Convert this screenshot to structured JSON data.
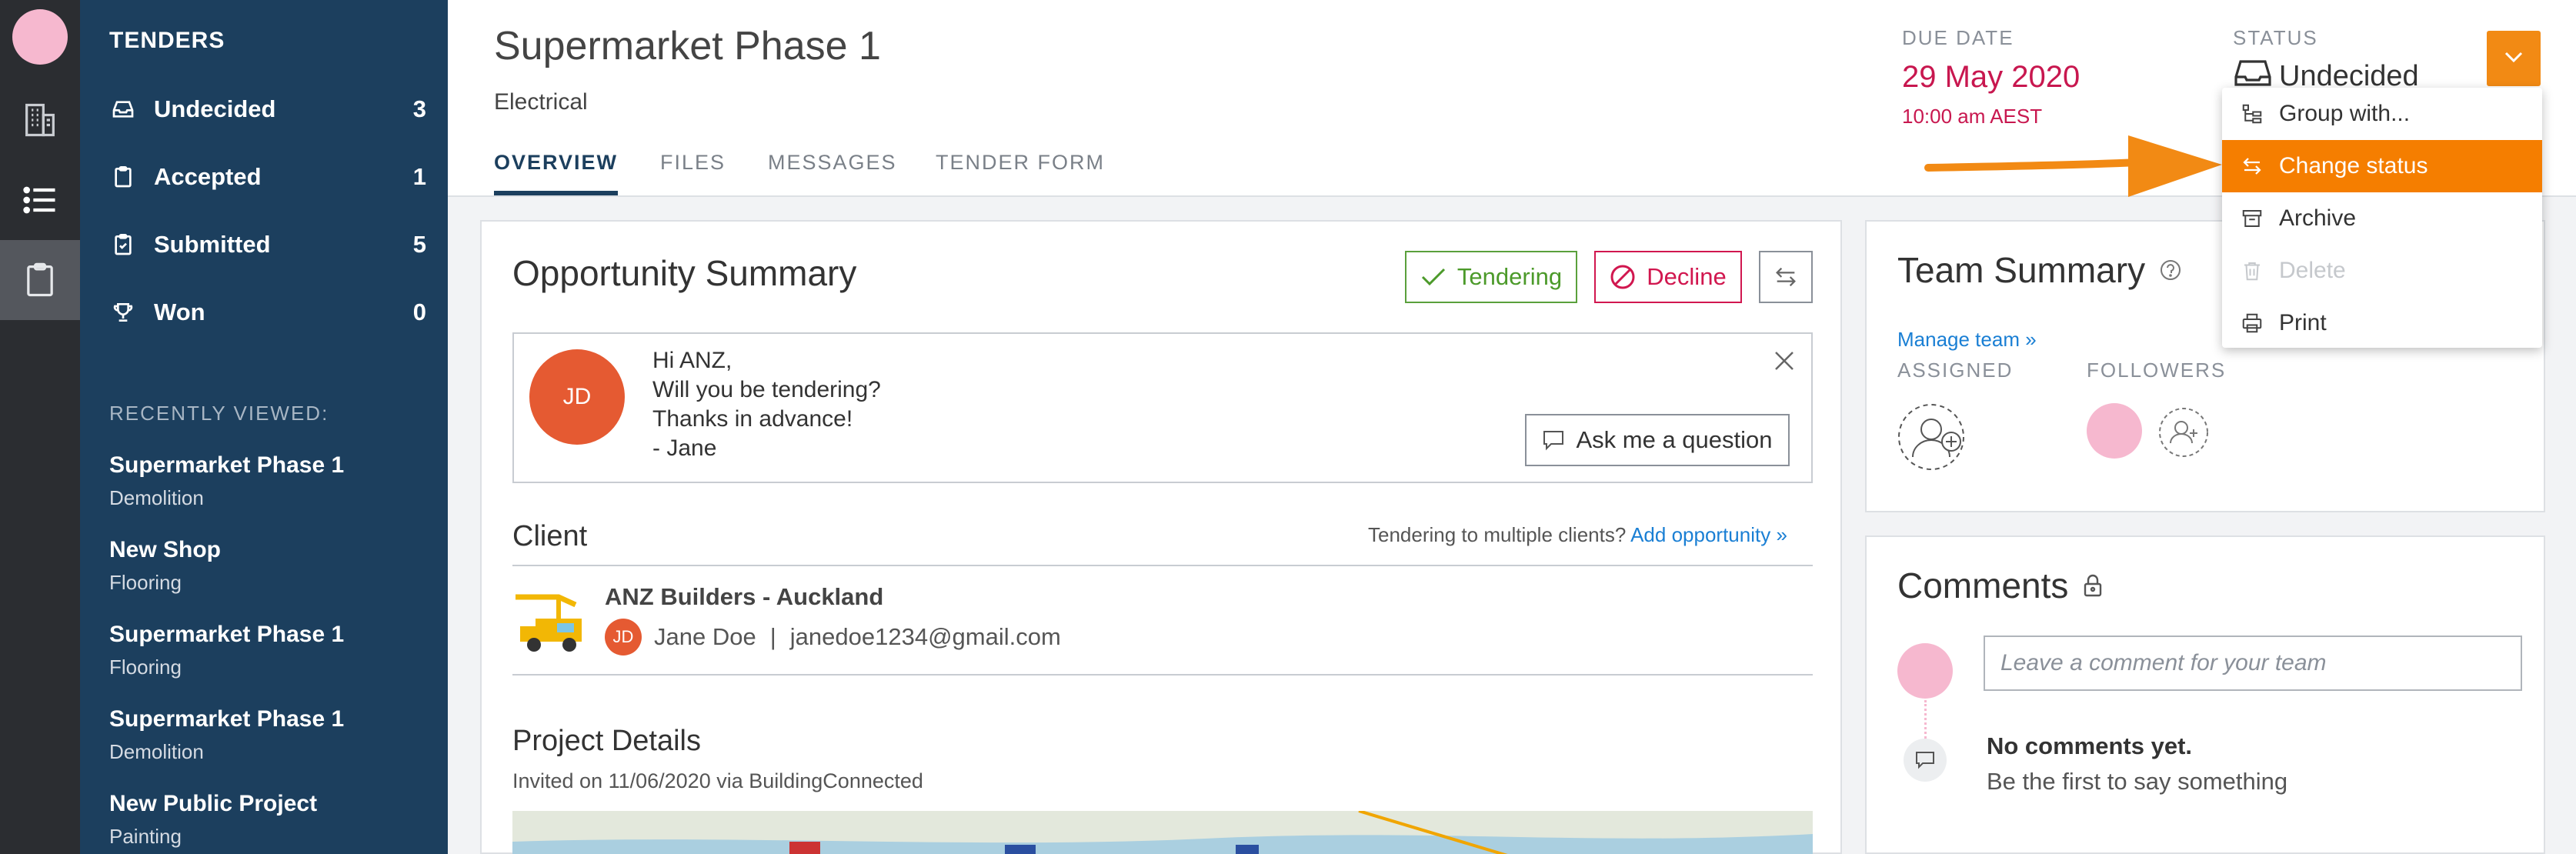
{
  "sidebar": {
    "title": "TENDERS",
    "items": [
      {
        "label": "Undecided",
        "count": "3",
        "icon": "inbox-icon"
      },
      {
        "label": "Accepted",
        "count": "1",
        "icon": "clipboard-icon"
      },
      {
        "label": "Submitted",
        "count": "5",
        "icon": "clipboard-check-icon"
      },
      {
        "label": "Won",
        "count": "0",
        "icon": "trophy-icon"
      }
    ],
    "recent_label": "RECENTLY VIEWED:",
    "recent": [
      {
        "title": "Supermarket Phase 1",
        "sub": "Demolition"
      },
      {
        "title": "New Shop",
        "sub": "Flooring"
      },
      {
        "title": "Supermarket Phase 1",
        "sub": "Flooring"
      },
      {
        "title": "Supermarket Phase 1",
        "sub": "Demolition"
      },
      {
        "title": "New Public Project",
        "sub": "Painting"
      }
    ]
  },
  "header": {
    "title": "Supermarket Phase 1",
    "subtitle": "Electrical",
    "tabs": [
      "OVERVIEW",
      "FILES",
      "MESSAGES",
      "TENDER FORM"
    ],
    "due_label": "DUE DATE",
    "due_date": "29 May 2020",
    "due_time": "10:00 am AEST",
    "status_label": "STATUS",
    "status_value": "Undecided"
  },
  "menu": {
    "items": [
      "Group with...",
      "Change status",
      "Archive",
      "Delete",
      "Print"
    ]
  },
  "opportunity": {
    "title": "Opportunity Summary",
    "tendering": "Tendering",
    "decline": "Decline",
    "avatar": "JD",
    "message": [
      "Hi ANZ,",
      "Will you be tendering?",
      "Thanks in advance!",
      "- Jane"
    ],
    "ask": "Ask me a question"
  },
  "client": {
    "heading": "Client",
    "note": "Tendering to multiple clients?",
    "add": "Add opportunity »",
    "name": "ANZ Builders - Auckland",
    "avatar": "JD",
    "contact": "Jane Doe",
    "sep": "|",
    "email": "janedoe1234@gmail.com"
  },
  "project": {
    "heading": "Project Details",
    "invited": "Invited on 11/06/2020 via BuildingConnected"
  },
  "team": {
    "title": "Team Summary",
    "manage": "Manage team »",
    "assigned": "ASSIGNED",
    "followers": "FOLLOWERS"
  },
  "comments": {
    "title": "Comments",
    "placeholder": "Leave a comment for your team",
    "empty": "No comments yet.",
    "empty_sub": "Be the first to say something"
  }
}
